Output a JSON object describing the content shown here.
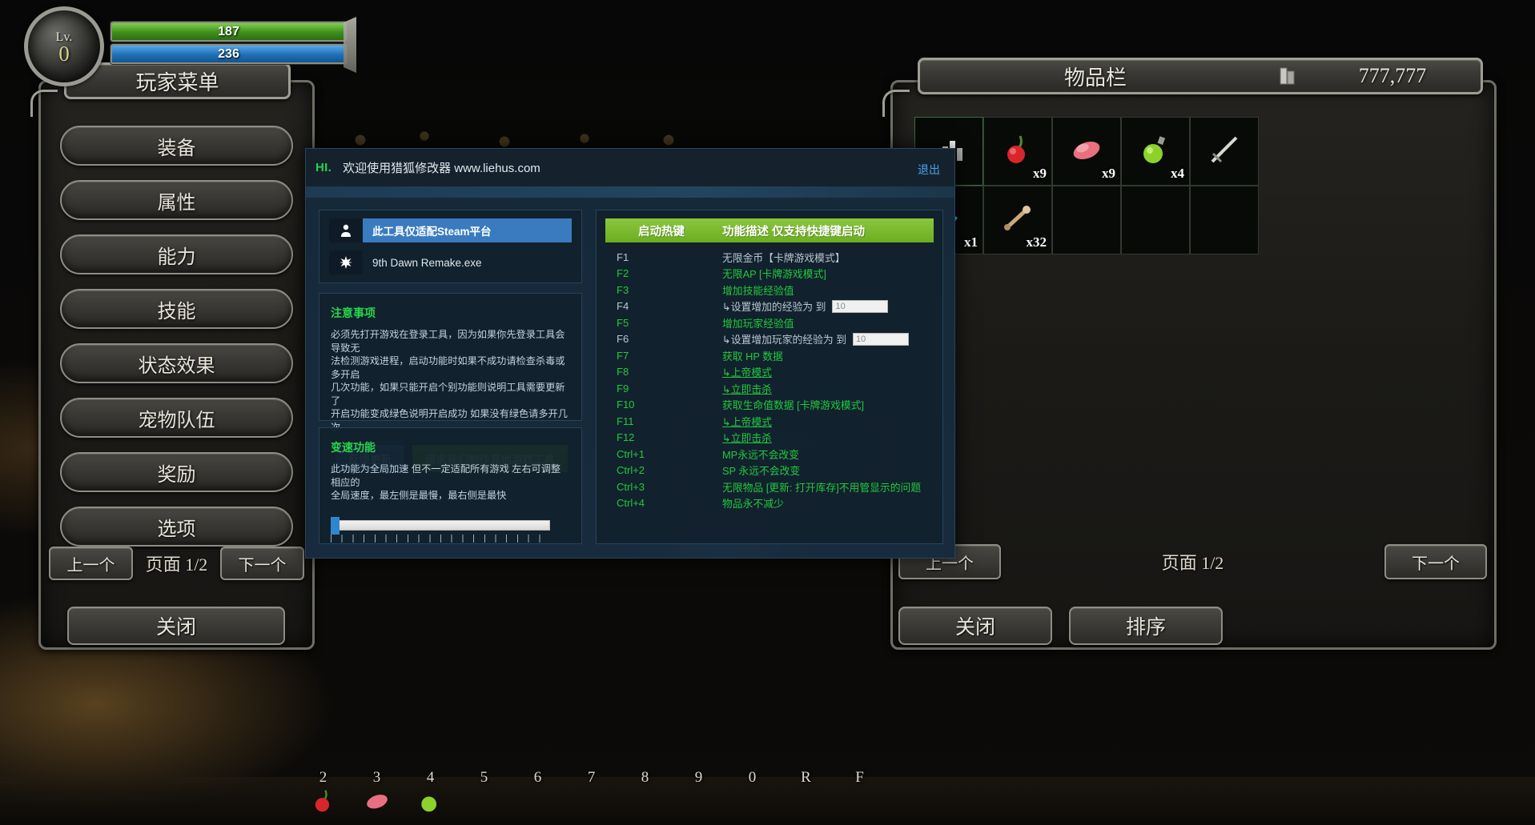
{
  "game": {
    "level": {
      "label": "Lv.",
      "value": "0"
    },
    "bars": [
      {
        "name": "health",
        "value": "187",
        "color": "#4f9c1f"
      },
      {
        "name": "mana",
        "value": "236",
        "color": "#2272b8"
      }
    ],
    "player_menu": {
      "title": "玩家菜单",
      "items": [
        "装备",
        "属性",
        "能力",
        "技能",
        "状态效果",
        "宠物队伍",
        "奖励",
        "选项"
      ],
      "prev_label": "上一个",
      "page_label": "页面 1/2",
      "next_label": "下一个",
      "close_label": "关闭"
    },
    "inventory": {
      "title": "物品栏",
      "currency": "777,777",
      "currency_icon": "coin-stack-icon",
      "prev_label": "上一个",
      "page_label": "页面 1/2",
      "next_label": "下一个",
      "close_label": "关闭",
      "sort_label": "排序",
      "slots": [
        {
          "icon": "bar-chart-icon",
          "qty": "",
          "selected": true
        },
        {
          "icon": "cherry-icon",
          "qty": "x9"
        },
        {
          "icon": "meat-icon",
          "qty": "x9"
        },
        {
          "icon": "green-potion-icon",
          "qty": "x4"
        },
        {
          "icon": "sword-icon",
          "qty": ""
        },
        {
          "icon": "ice-shard-icon",
          "qty": "x1"
        },
        {
          "icon": "bone-icon",
          "qty": "x32"
        },
        {
          "icon": "",
          "qty": ""
        },
        {
          "icon": "",
          "qty": ""
        },
        {
          "icon": "",
          "qty": ""
        }
      ]
    },
    "hotbar": [
      {
        "key": "2",
        "icon": "cherry-icon"
      },
      {
        "key": "3",
        "icon": "meat-icon"
      },
      {
        "key": "4",
        "icon": "green-potion-icon"
      },
      {
        "key": "5",
        "icon": ""
      },
      {
        "key": "6",
        "icon": ""
      },
      {
        "key": "7",
        "icon": ""
      },
      {
        "key": "8",
        "icon": ""
      },
      {
        "key": "9",
        "icon": ""
      },
      {
        "key": "0",
        "icon": ""
      },
      {
        "key": "R",
        "icon": ""
      },
      {
        "key": "F",
        "icon": ""
      }
    ]
  },
  "trainer": {
    "title_tag": "HI.",
    "title_text": "欢迎使用猎狐修改器 www.liehus.com",
    "exit_label": "退出",
    "platform": {
      "platform_icon": "person-icon",
      "platform_label": "此工具仅适配Steam平台",
      "process_icon": "sun-burst-icon",
      "process_label": "9th Dawn Remake.exe"
    },
    "notes": {
      "heading": "注意事项",
      "lines": [
        "必须先打开游戏在登录工具，因为如果你先登录工具会导致无",
        "法检测游戏进程，启动功能时如果不成功请检查杀毒或多开启",
        "几次功能，如果只能开启个别功能则说明工具需要更新了",
        "开启功能变成绿色说明开启成功 如果没有绿色请多开几次"
      ],
      "feedback_button": "反馈更新",
      "request_button": "请求我们制作其他游戏工具"
    },
    "speed": {
      "heading": "变速功能",
      "lines": [
        "此功能为全局加速 但不一定适配所有游戏 左右可调整相应的",
        "全局速度，最左侧是最慢，最右侧是最快"
      ],
      "slider_value": 0
    },
    "hotkeys": {
      "col_key": "启动热键",
      "col_desc": "功能描述 仅支持快捷键启动",
      "rows": [
        {
          "key": "F1",
          "desc": "无限金币【卡牌游戏模式】",
          "active": false
        },
        {
          "key": "F2",
          "desc": "无限AP [卡牌游戏模式]",
          "active": true
        },
        {
          "key": "F3",
          "desc": "增加技能经验值",
          "active": true
        },
        {
          "key": "F4",
          "desc": "↳设置增加的经验为 到",
          "active": false,
          "input": "10"
        },
        {
          "key": "F5",
          "desc": "增加玩家经验值",
          "active": true
        },
        {
          "key": "F6",
          "desc": "↳设置增加玩家的经验为 到",
          "active": false,
          "input": "10"
        },
        {
          "key": "F7",
          "desc": "获取 HP 数据",
          "active": true
        },
        {
          "key": "F8",
          "desc": "↳上帝模式",
          "active": true,
          "underline": true
        },
        {
          "key": "F9",
          "desc": "↳立即击杀",
          "active": true,
          "underline": true
        },
        {
          "key": "F10",
          "desc": "获取生命值数据 [卡牌游戏模式]",
          "active": true
        },
        {
          "key": "F11",
          "desc": "↳上帝模式",
          "active": true,
          "underline": true
        },
        {
          "key": "F12",
          "desc": "↳立即击杀",
          "active": true,
          "underline": true
        },
        {
          "key": "Ctrl+1",
          "desc": "MP永远不会改变",
          "active": true
        },
        {
          "key": "Ctrl+2",
          "desc": "SP 永远不会改变",
          "active": true
        },
        {
          "key": "Ctrl+3",
          "desc": "无限物品 [更新: 打开库存]不用管显示的问题",
          "active": true
        },
        {
          "key": "Ctrl+4",
          "desc": "物品永不减少",
          "active": true
        }
      ]
    }
  },
  "colors": {
    "accent_green": "#22c93e",
    "header_green": "#8cc63f",
    "blue_button": "#2f7fc4",
    "link_blue": "#4aa3e8",
    "highlight_blue": "#3a7bbf"
  }
}
